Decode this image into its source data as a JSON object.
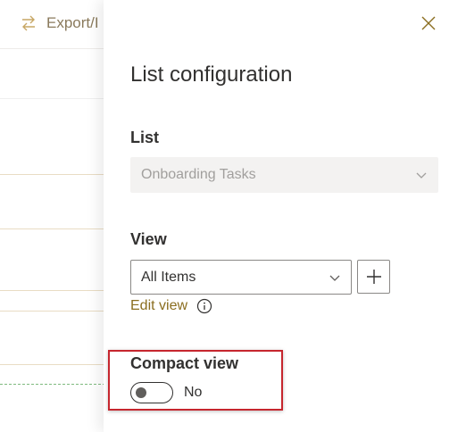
{
  "background": {
    "export_label": "Export/I"
  },
  "panel": {
    "title": "List configuration",
    "list_field": {
      "label": "List",
      "value": "Onboarding Tasks"
    },
    "view_field": {
      "label": "View",
      "value": "All Items",
      "edit_link": "Edit view"
    },
    "compact_view": {
      "label": "Compact view",
      "state_text": "No",
      "enabled": false
    }
  },
  "colors": {
    "accent_link": "#8a6d1f",
    "highlight_box": "#c6262e",
    "disabled_bg": "#f3f2f1"
  },
  "icons": {
    "export": "arrows-exchange-icon",
    "close": "close-icon",
    "dropdown": "chevron-down-icon",
    "add": "plus-icon",
    "info": "info-icon"
  }
}
